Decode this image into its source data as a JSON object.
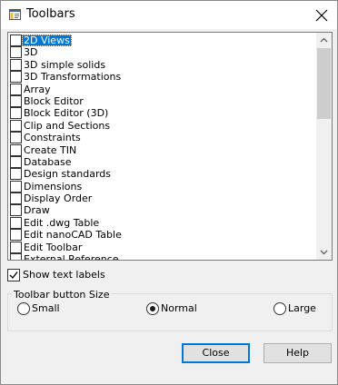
{
  "window": {
    "title": "Toolbars"
  },
  "toolbars": [
    {
      "label": "2D Views",
      "checked": false,
      "selected": true
    },
    {
      "label": "3D",
      "checked": false
    },
    {
      "label": "3D simple solids",
      "checked": false
    },
    {
      "label": "3D Transformations",
      "checked": false
    },
    {
      "label": "Array",
      "checked": false
    },
    {
      "label": "Block Editor",
      "checked": false
    },
    {
      "label": "Block Editor (3D)",
      "checked": false
    },
    {
      "label": "Clip and Sections",
      "checked": false
    },
    {
      "label": "Constraints",
      "checked": false
    },
    {
      "label": "Create TIN",
      "checked": false
    },
    {
      "label": "Database",
      "checked": false
    },
    {
      "label": "Design standards",
      "checked": false
    },
    {
      "label": "Dimensions",
      "checked": false
    },
    {
      "label": "Display Order",
      "checked": false
    },
    {
      "label": "Draw",
      "checked": false
    },
    {
      "label": "Edit .dwg Table",
      "checked": false
    },
    {
      "label": "Edit nanoCAD Table",
      "checked": false
    },
    {
      "label": "Edit Toolbar",
      "checked": false
    },
    {
      "label": "External Reference",
      "checked": false
    }
  ],
  "options": {
    "show_text_labels": "Show text labels",
    "show_text_checked": true
  },
  "button_size": {
    "title": "Toolbar button Size",
    "small": "Small",
    "normal": "Normal",
    "large": "Large",
    "selected": "normal"
  },
  "buttons": {
    "close": "Close",
    "help": "Help"
  }
}
